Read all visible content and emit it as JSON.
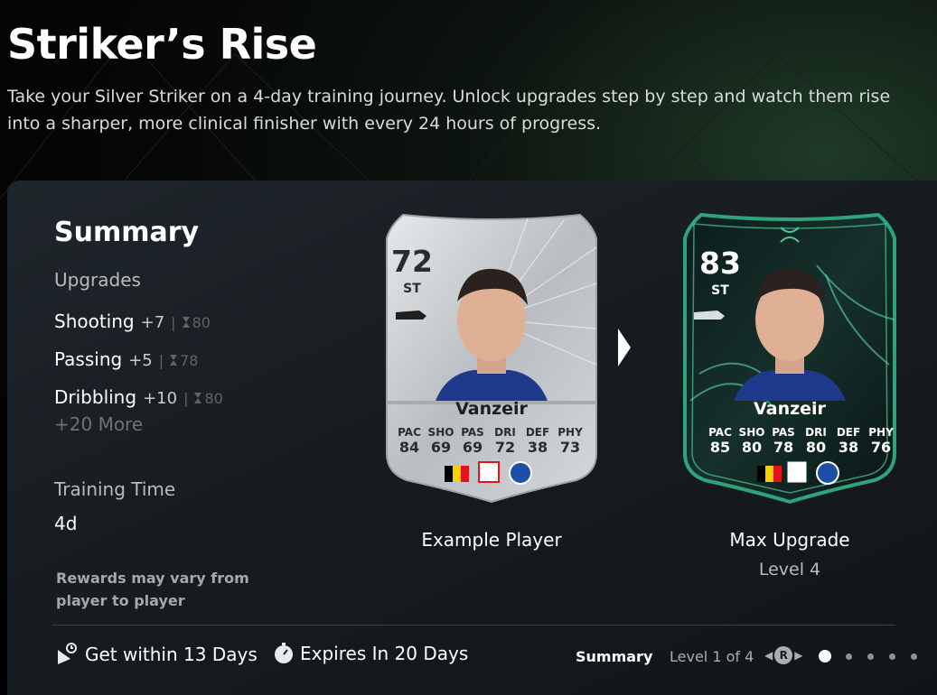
{
  "header": {
    "title": "Striker’s Rise",
    "description": "Take your Silver Striker on a 4-day training journey. Unlock upgrades step by step and watch them rise into a sharper, more clinical finisher with every 24 hours of progress."
  },
  "summary": {
    "heading": "Summary",
    "upgrades_label": "Upgrades",
    "upgrades": [
      {
        "name": "Shooting",
        "plus": "+7",
        "cap": "80"
      },
      {
        "name": "Passing",
        "plus": "+5",
        "cap": "78"
      },
      {
        "name": "Dribbling",
        "plus": "+10",
        "cap": "80"
      }
    ],
    "more": "+20 More",
    "training_time_label": "Training Time",
    "training_time_value": "4d",
    "rewards_note": "Rewards may vary from player to player"
  },
  "cards": {
    "example": {
      "rating": "72",
      "position": "ST",
      "name": "Vanzeir",
      "stat_labels": [
        "PAC",
        "SHO",
        "PAS",
        "DRI",
        "DEF",
        "PHY"
      ],
      "stat_values": [
        "84",
        "69",
        "69",
        "72",
        "38",
        "73"
      ],
      "caption": "Example Player"
    },
    "max": {
      "rating": "83",
      "position": "ST",
      "name": "Vanzeir",
      "stat_labels": [
        "PAC",
        "SHO",
        "PAS",
        "DRI",
        "DEF",
        "PHY"
      ],
      "stat_values": [
        "85",
        "80",
        "78",
        "80",
        "38",
        "76"
      ],
      "caption": "Max Upgrade",
      "level": "Level 4"
    }
  },
  "footer": {
    "get_within": "Get within 13 Days",
    "expires": "Expires In 20 Days",
    "nav_summary": "Summary",
    "nav_level": "Level 1 of 4",
    "nav_button": "R",
    "pages_total": 5,
    "pages_active": 1
  },
  "colors": {
    "accent_green": "#2fa37b",
    "silver": "#c9ccd0",
    "card_dark": "#16302b"
  }
}
